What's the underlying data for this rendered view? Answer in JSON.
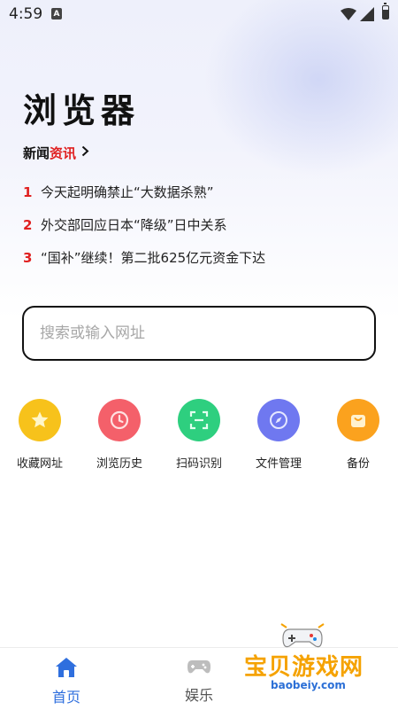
{
  "status_bar": {
    "time": "4:59",
    "notification_badge": "A"
  },
  "logo": {
    "text": "浏览器"
  },
  "news": {
    "header_part1": "新闻",
    "header_part2": "资讯",
    "items": [
      {
        "rank": "1",
        "title": "今天起明确禁止“大数据杀熟”"
      },
      {
        "rank": "2",
        "title": "外交部回应日本“降级”日中关系"
      },
      {
        "rank": "3",
        "title": "“国补”继续！第二批625亿元资金下达"
      }
    ]
  },
  "search": {
    "placeholder": "搜索或输入网址",
    "value": ""
  },
  "quick_actions": [
    {
      "label": "收藏网址",
      "icon": "star-icon",
      "color": "#f7c21b"
    },
    {
      "label": "浏览历史",
      "icon": "clock-icon",
      "color": "#f4606a"
    },
    {
      "label": "扫码识别",
      "icon": "scan-icon",
      "color": "#2ecf7f"
    },
    {
      "label": "文件管理",
      "icon": "compass-icon",
      "color": "#6f78f0"
    },
    {
      "label": "备份",
      "icon": "bag-icon",
      "color": "#fba21e"
    }
  ],
  "bottom_nav": {
    "tabs": [
      {
        "label": "首页",
        "icon": "home-icon",
        "active": true
      },
      {
        "label": "娱乐",
        "icon": "gamepad-icon",
        "active": false
      }
    ],
    "active_color": "#2f6fde",
    "inactive_color": "#555555"
  },
  "watermark": {
    "text": "宝贝游戏网",
    "domain": "baobeiy.com"
  }
}
